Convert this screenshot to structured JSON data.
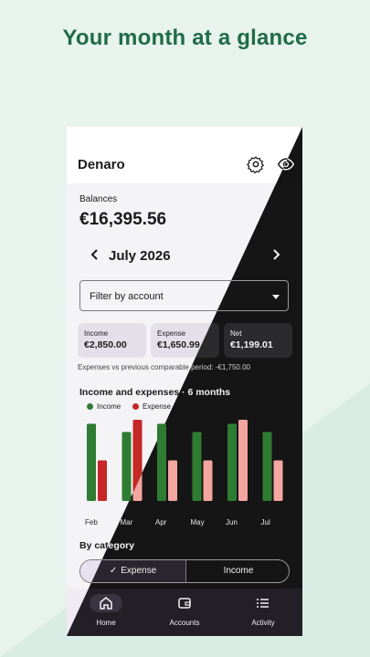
{
  "headline": "Your month at a glance",
  "app": {
    "title": "Denaro"
  },
  "balances": {
    "label": "Balances",
    "value": "€16,395.56"
  },
  "period": {
    "month": "July 2026"
  },
  "filter": {
    "placeholder": "Filter by account"
  },
  "stats": [
    {
      "label": "Income",
      "value": "€2,850.00"
    },
    {
      "label": "Expense",
      "value": "€1,650.99"
    },
    {
      "label": "Net",
      "value": "€1,199.01"
    }
  ],
  "compare_text": "Expenses vs previous comparable period: -€1,750.00",
  "chart_title": "Income and expenses · 6 months",
  "chart_data": {
    "type": "bar",
    "categories": [
      "Feb",
      "Mar",
      "Apr",
      "May",
      "Jun",
      "Jul"
    ],
    "series": [
      {
        "name": "Income",
        "values": [
          2850,
          2550,
          2850,
          2550,
          2850,
          2550
        ]
      },
      {
        "name": "Expense",
        "values": [
          1500,
          3000,
          1500,
          1500,
          3000,
          1500
        ]
      }
    ],
    "ylim": [
      0,
      3100
    ],
    "colors": {
      "income": "#2e7d32",
      "expense_light": "#c62828",
      "expense_dark": "#f4a6a0"
    },
    "legend": "top-left"
  },
  "category_title": "By category",
  "segments": {
    "expense": "Expense",
    "income": "Income"
  },
  "nav": {
    "home": "Home",
    "accounts": "Accounts",
    "activity": "Activity"
  },
  "icons": [
    "gear-icon",
    "eye-icon",
    "chevron-left-icon",
    "chevron-right-icon",
    "dropdown-arrow-icon",
    "check-icon",
    "home-icon",
    "wallet-icon",
    "list-icon"
  ]
}
